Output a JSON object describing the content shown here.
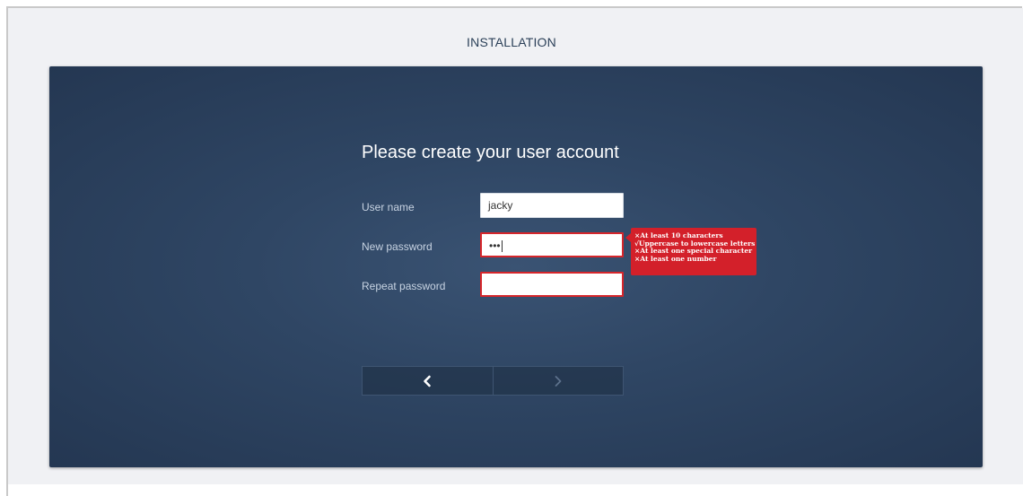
{
  "header": {
    "title": "INSTALLATION"
  },
  "form": {
    "title": "Please create your user account",
    "username": {
      "label": "User name",
      "value": "jacky"
    },
    "new_password": {
      "label": "New password",
      "value": "•••"
    },
    "repeat_password": {
      "label": "Repeat password",
      "value": ""
    }
  },
  "password_rules": [
    "×At least 10 characters",
    "√Uppercase to lowercase letters",
    "×At least one special character",
    "×At least one number"
  ],
  "nav": {
    "back_icon": "chevron-left-icon",
    "next_icon": "chevron-right-icon"
  },
  "colors": {
    "panel": "#2f4664",
    "error": "#d3202a",
    "header_text": "#2b4058"
  }
}
